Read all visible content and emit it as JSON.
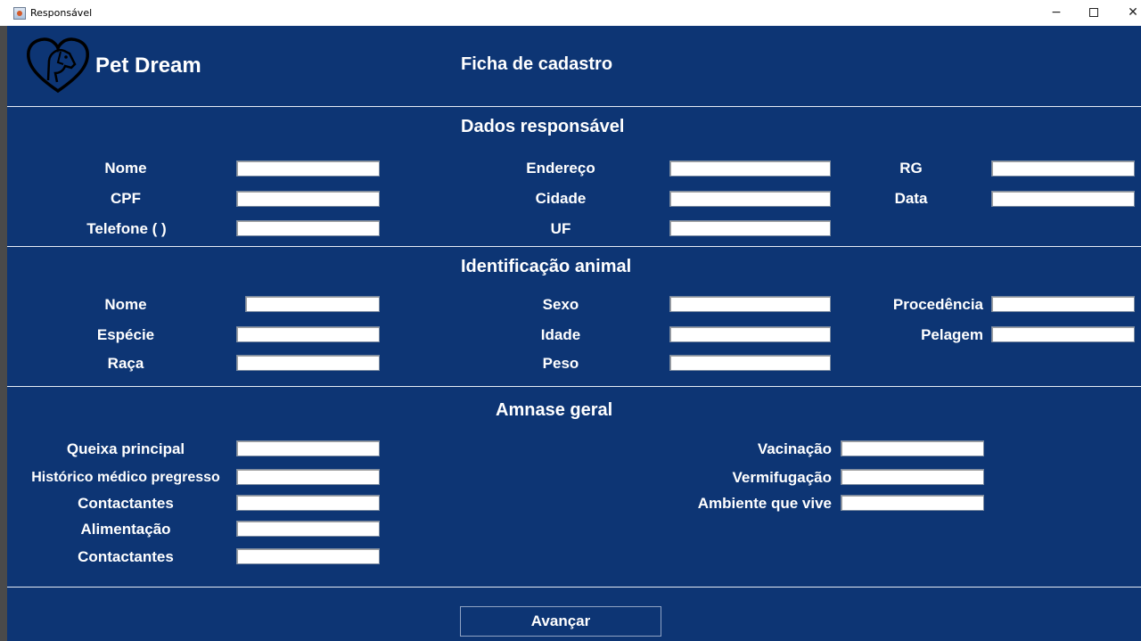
{
  "window": {
    "title": "Responsável",
    "minimize": "−",
    "close": "✕"
  },
  "header": {
    "brand": "Pet Dream",
    "form_title": "Ficha de cadastro",
    "logo_icon": "heart-dog-icon"
  },
  "responsavel": {
    "title": "Dados responsável",
    "nome": "Nome",
    "cpf": "CPF",
    "telefone": "Telefone  ( )",
    "endereco": "Endereço",
    "cidade": "Cidade",
    "uf": "UF",
    "rg": "RG",
    "data": "Data"
  },
  "animal": {
    "title": "Identificação animal",
    "nome": "Nome",
    "especie": "Espécie",
    "raca": "Raça",
    "sexo": "Sexo",
    "idade": "Idade",
    "peso": "Peso",
    "procedencia": "Procedência",
    "pelagem": "Pelagem"
  },
  "amnase": {
    "title": "Amnase geral",
    "queixa": "Queixa principal",
    "historico": "Histórico médico pregresso",
    "contactantes1": "Contactantes",
    "alimentacao": "Alimentação",
    "contactantes2": "Contactantes",
    "vacinacao": "Vacinação",
    "vermifugacao": "Vermifugação",
    "ambiente": "Ambiente que vive"
  },
  "actions": {
    "avancar": "Avançar"
  },
  "colors": {
    "background": "#0d3574",
    "text": "#ffffff"
  }
}
